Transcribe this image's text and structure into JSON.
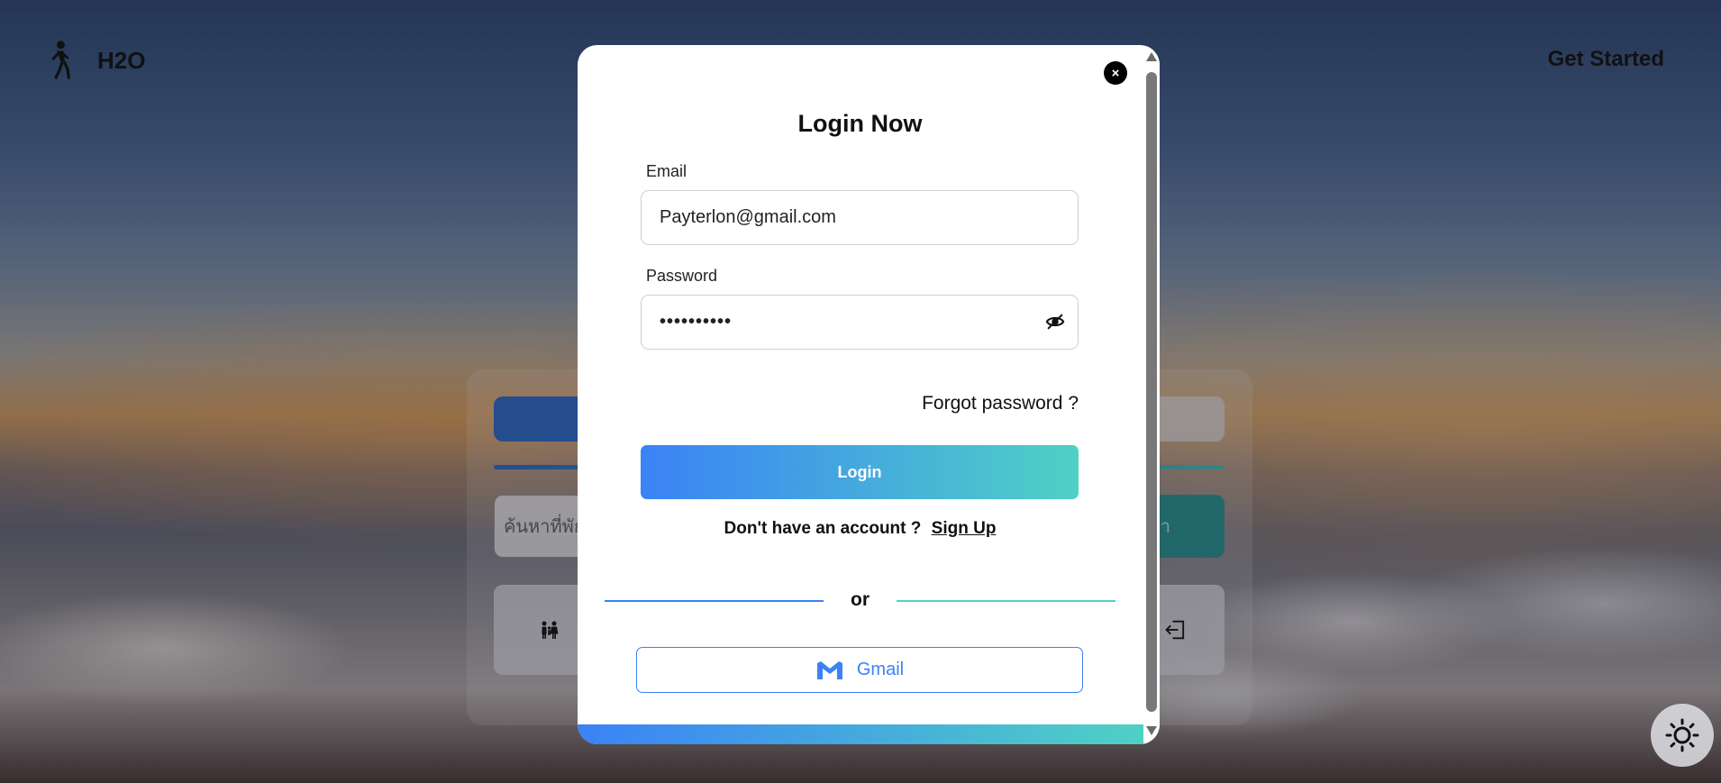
{
  "header": {
    "brand": "H2O",
    "get_started": "Get Started"
  },
  "background_card": {
    "search_placeholder": "ค้นหาที่พัก",
    "search_button": "หา"
  },
  "modal": {
    "title": "Login Now",
    "email_label": "Email",
    "email_value": "Payterlon@gmail.com",
    "password_label": "Password",
    "password_value": "••••••••••",
    "forgot_password": "Forgot password ?",
    "login_button": "Login",
    "no_account_text": "Don't have an account ?",
    "signup_link": "Sign Up",
    "divider_text": "or",
    "gmail_button": "Gmail"
  },
  "colors": {
    "accent_blue": "#3b82f6",
    "accent_teal": "#4fd1c5"
  },
  "icons": {
    "logo": "walking-person-icon",
    "close": "close-icon",
    "password_toggle": "eye-slash-icon",
    "gmail": "gmail-icon",
    "theme": "sun-icon",
    "guests": "family-icon",
    "login": "sign-in-icon"
  }
}
